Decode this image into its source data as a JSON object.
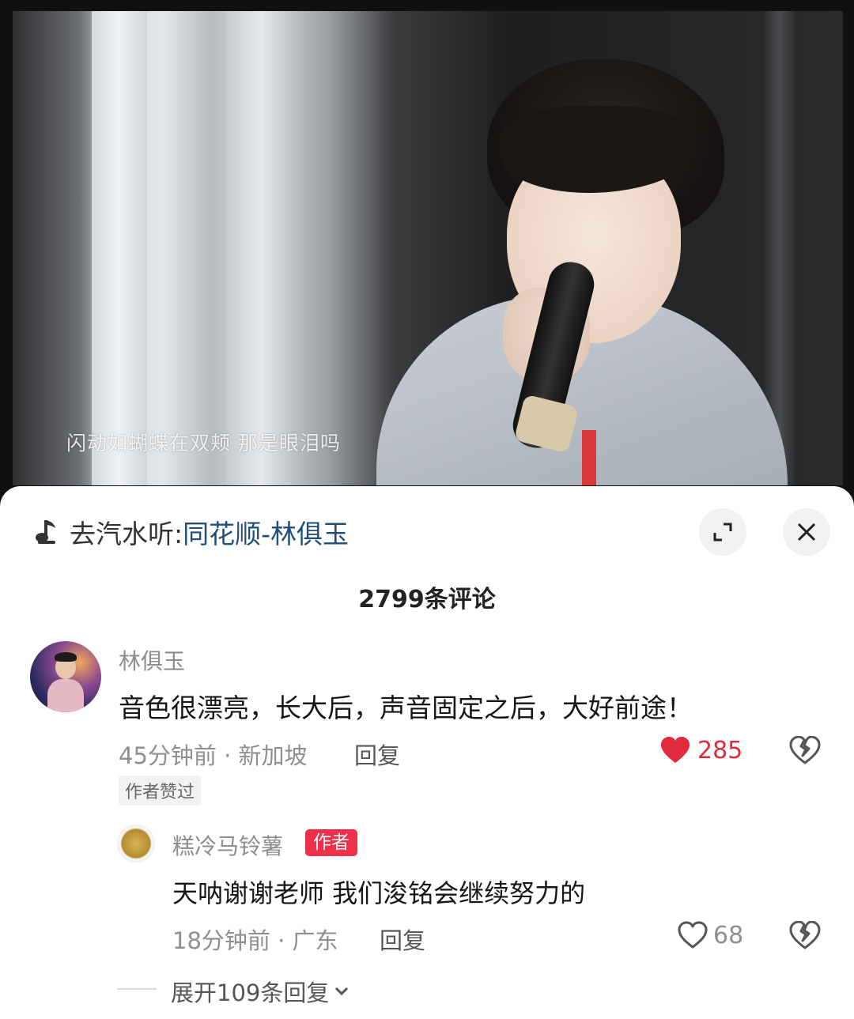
{
  "video": {
    "subtitle": "闪动如蝴蝶在双颊 那是眼泪吗"
  },
  "music": {
    "prefix": "去汽水听:",
    "song": "同花顺-林俱玉",
    "icon": "music-note-icon"
  },
  "controls": {
    "expand_icon": "expand-icon",
    "close_icon": "close-icon"
  },
  "comments_header": {
    "count_label": "2799条评论"
  },
  "comment": {
    "username": "林俱玉",
    "text": "音色很漂亮，长大后，声音固定之后，大好前途！",
    "meta": "45分钟前 · 新加坡",
    "reply_label": "回复",
    "likes": "285",
    "liked": true,
    "badge": "作者赞过"
  },
  "reply": {
    "username": "糕冷马铃薯",
    "author_tag": "作者",
    "text": "天呐谢谢老师 我们浚铭会继续努力的",
    "meta": "18分钟前 · 广东",
    "reply_label": "回复",
    "likes": "68",
    "liked": false
  },
  "expand_replies": {
    "label": "展开109条回复"
  },
  "colors": {
    "like_red": "#e02b3c",
    "author_tag_bg": "#f0304a",
    "link_blue": "#1f4e79"
  }
}
